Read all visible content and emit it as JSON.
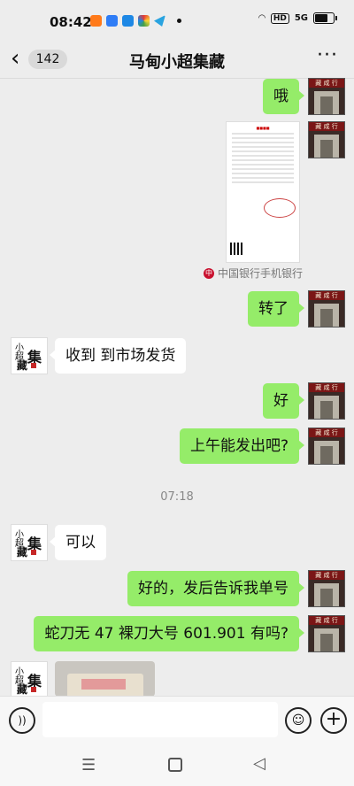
{
  "status_bar": {
    "time": "08:42",
    "hd": "HD",
    "signal": "5G"
  },
  "header": {
    "back_icon": "chevron-left",
    "unread_count": "142",
    "title": "马甸小超集藏",
    "more_icon": "more-dots"
  },
  "avatar_text": {
    "shop_sign": "藏 咸 行",
    "logo_1": "小",
    "logo_2": "超",
    "logo_3": "集",
    "logo_4": "藏"
  },
  "messages": [
    {
      "from": "me",
      "text": "哦"
    },
    {
      "from": "me",
      "type": "image",
      "caption": "中国银行手机银行"
    },
    {
      "from": "me",
      "text": "转了"
    },
    {
      "from": "them",
      "text": "收到 到市场发货"
    },
    {
      "from": "me",
      "text": "好"
    },
    {
      "from": "me",
      "text": "上午能发出吧?"
    },
    {
      "from": "system",
      "text": "07:18"
    },
    {
      "from": "them",
      "text": "可以"
    },
    {
      "from": "me",
      "text": "好的，发后告诉我单号"
    },
    {
      "from": "me",
      "text": "蛇刀无 47 裸刀大号 601.901 有吗?"
    },
    {
      "from": "them",
      "type": "image"
    }
  ],
  "input": {
    "placeholder": ""
  },
  "colors": {
    "my_bubble": "#95ec69",
    "their_bubble": "#ffffff",
    "background": "#ededed"
  }
}
